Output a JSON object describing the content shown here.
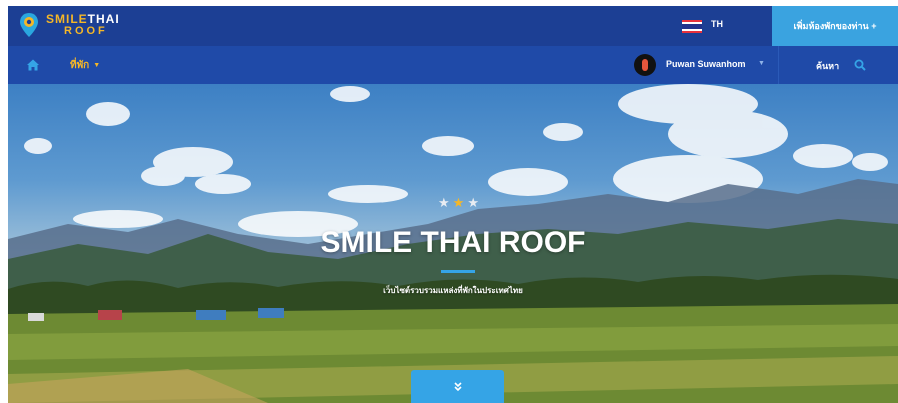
{
  "header": {
    "logo_part1": "SMILE",
    "logo_part2": "THAI",
    "logo_line2": "ROOF",
    "language": "TH",
    "add_listing_label": "เพิ่มห้องพักของท่าน +"
  },
  "nav": {
    "accommodation_label": "ที่พัก",
    "user_name": "Puwan Suwanhom",
    "search_label": "ค้นหา"
  },
  "hero": {
    "title": "SMILE THAI ROOF",
    "subtitle": "เว็บไซต์รวบรวมแหล่งที่พักในประเทศไทย",
    "rating_value": 3,
    "rating_max": 3,
    "scroll_icon": "double-chevron-down-icon"
  },
  "colors": {
    "topbar": "#1c3f94",
    "navbar": "#1f4aa8",
    "accent_blue": "#35a4e6",
    "brand_yellow": "#f5b727"
  }
}
